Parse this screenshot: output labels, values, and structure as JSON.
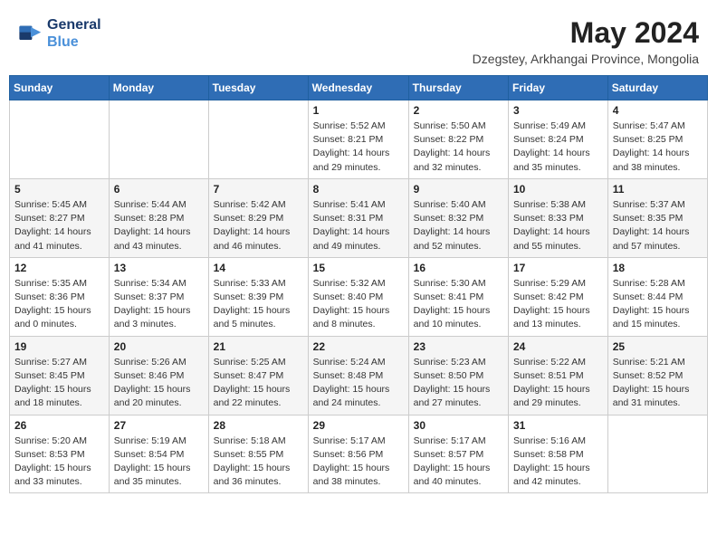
{
  "logo": {
    "line1": "General",
    "line2": "Blue"
  },
  "title": "May 2024",
  "location": "Dzegstey, Arkhangai Province, Mongolia",
  "weekdays": [
    "Sunday",
    "Monday",
    "Tuesday",
    "Wednesday",
    "Thursday",
    "Friday",
    "Saturday"
  ],
  "weeks": [
    [
      {
        "day": "",
        "info": ""
      },
      {
        "day": "",
        "info": ""
      },
      {
        "day": "",
        "info": ""
      },
      {
        "day": "1",
        "info": "Sunrise: 5:52 AM\nSunset: 8:21 PM\nDaylight: 14 hours\nand 29 minutes."
      },
      {
        "day": "2",
        "info": "Sunrise: 5:50 AM\nSunset: 8:22 PM\nDaylight: 14 hours\nand 32 minutes."
      },
      {
        "day": "3",
        "info": "Sunrise: 5:49 AM\nSunset: 8:24 PM\nDaylight: 14 hours\nand 35 minutes."
      },
      {
        "day": "4",
        "info": "Sunrise: 5:47 AM\nSunset: 8:25 PM\nDaylight: 14 hours\nand 38 minutes."
      }
    ],
    [
      {
        "day": "5",
        "info": "Sunrise: 5:45 AM\nSunset: 8:27 PM\nDaylight: 14 hours\nand 41 minutes."
      },
      {
        "day": "6",
        "info": "Sunrise: 5:44 AM\nSunset: 8:28 PM\nDaylight: 14 hours\nand 43 minutes."
      },
      {
        "day": "7",
        "info": "Sunrise: 5:42 AM\nSunset: 8:29 PM\nDaylight: 14 hours\nand 46 minutes."
      },
      {
        "day": "8",
        "info": "Sunrise: 5:41 AM\nSunset: 8:31 PM\nDaylight: 14 hours\nand 49 minutes."
      },
      {
        "day": "9",
        "info": "Sunrise: 5:40 AM\nSunset: 8:32 PM\nDaylight: 14 hours\nand 52 minutes."
      },
      {
        "day": "10",
        "info": "Sunrise: 5:38 AM\nSunset: 8:33 PM\nDaylight: 14 hours\nand 55 minutes."
      },
      {
        "day": "11",
        "info": "Sunrise: 5:37 AM\nSunset: 8:35 PM\nDaylight: 14 hours\nand 57 minutes."
      }
    ],
    [
      {
        "day": "12",
        "info": "Sunrise: 5:35 AM\nSunset: 8:36 PM\nDaylight: 15 hours\nand 0 minutes."
      },
      {
        "day": "13",
        "info": "Sunrise: 5:34 AM\nSunset: 8:37 PM\nDaylight: 15 hours\nand 3 minutes."
      },
      {
        "day": "14",
        "info": "Sunrise: 5:33 AM\nSunset: 8:39 PM\nDaylight: 15 hours\nand 5 minutes."
      },
      {
        "day": "15",
        "info": "Sunrise: 5:32 AM\nSunset: 8:40 PM\nDaylight: 15 hours\nand 8 minutes."
      },
      {
        "day": "16",
        "info": "Sunrise: 5:30 AM\nSunset: 8:41 PM\nDaylight: 15 hours\nand 10 minutes."
      },
      {
        "day": "17",
        "info": "Sunrise: 5:29 AM\nSunset: 8:42 PM\nDaylight: 15 hours\nand 13 minutes."
      },
      {
        "day": "18",
        "info": "Sunrise: 5:28 AM\nSunset: 8:44 PM\nDaylight: 15 hours\nand 15 minutes."
      }
    ],
    [
      {
        "day": "19",
        "info": "Sunrise: 5:27 AM\nSunset: 8:45 PM\nDaylight: 15 hours\nand 18 minutes."
      },
      {
        "day": "20",
        "info": "Sunrise: 5:26 AM\nSunset: 8:46 PM\nDaylight: 15 hours\nand 20 minutes."
      },
      {
        "day": "21",
        "info": "Sunrise: 5:25 AM\nSunset: 8:47 PM\nDaylight: 15 hours\nand 22 minutes."
      },
      {
        "day": "22",
        "info": "Sunrise: 5:24 AM\nSunset: 8:48 PM\nDaylight: 15 hours\nand 24 minutes."
      },
      {
        "day": "23",
        "info": "Sunrise: 5:23 AM\nSunset: 8:50 PM\nDaylight: 15 hours\nand 27 minutes."
      },
      {
        "day": "24",
        "info": "Sunrise: 5:22 AM\nSunset: 8:51 PM\nDaylight: 15 hours\nand 29 minutes."
      },
      {
        "day": "25",
        "info": "Sunrise: 5:21 AM\nSunset: 8:52 PM\nDaylight: 15 hours\nand 31 minutes."
      }
    ],
    [
      {
        "day": "26",
        "info": "Sunrise: 5:20 AM\nSunset: 8:53 PM\nDaylight: 15 hours\nand 33 minutes."
      },
      {
        "day": "27",
        "info": "Sunrise: 5:19 AM\nSunset: 8:54 PM\nDaylight: 15 hours\nand 35 minutes."
      },
      {
        "day": "28",
        "info": "Sunrise: 5:18 AM\nSunset: 8:55 PM\nDaylight: 15 hours\nand 36 minutes."
      },
      {
        "day": "29",
        "info": "Sunrise: 5:17 AM\nSunset: 8:56 PM\nDaylight: 15 hours\nand 38 minutes."
      },
      {
        "day": "30",
        "info": "Sunrise: 5:17 AM\nSunset: 8:57 PM\nDaylight: 15 hours\nand 40 minutes."
      },
      {
        "day": "31",
        "info": "Sunrise: 5:16 AM\nSunset: 8:58 PM\nDaylight: 15 hours\nand 42 minutes."
      },
      {
        "day": "",
        "info": ""
      }
    ]
  ]
}
